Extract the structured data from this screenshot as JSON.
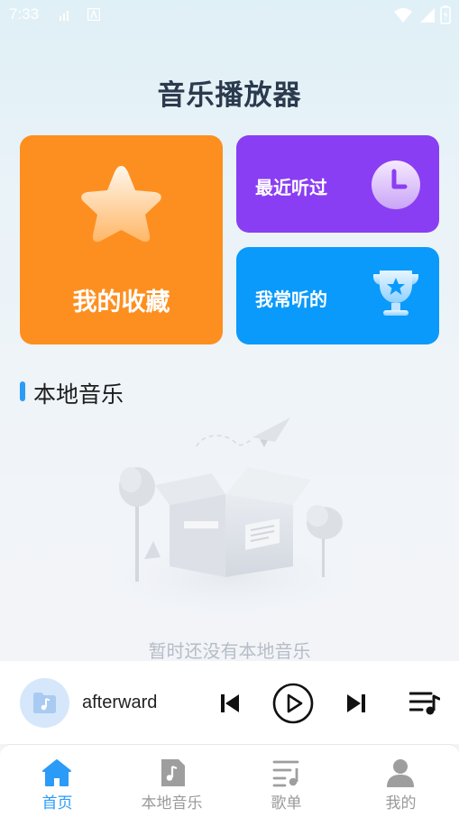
{
  "status_bar": {
    "time": "7:33"
  },
  "header": {
    "title": "音乐播放器"
  },
  "cards": {
    "favorites_label": "我的收藏",
    "recent_label": "最近听过",
    "frequent_label": "我常听的"
  },
  "local_music": {
    "section_title": "本地音乐",
    "empty_message": "暂时还没有本地音乐"
  },
  "player": {
    "song_title": "afterward"
  },
  "tabs": [
    {
      "label": "首页",
      "icon": "home-icon",
      "active": true
    },
    {
      "label": "本地音乐",
      "icon": "music-file-icon",
      "active": false
    },
    {
      "label": "歌单",
      "icon": "playlist-icon",
      "active": false
    },
    {
      "label": "我的",
      "icon": "person-icon",
      "active": false
    }
  ],
  "colors": {
    "accent": "#2b9bf8",
    "favorites_card": "#fd8f20",
    "recent_card": "#8a3ef3",
    "frequent_card": "#0a9afb"
  }
}
